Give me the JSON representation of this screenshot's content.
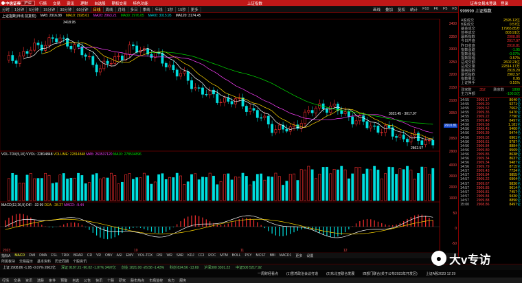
{
  "app": {
    "brand": "中信证券",
    "market_select": "沪深",
    "center_title": "上证指数",
    "menu": [
      "行情",
      "交易",
      "资讯",
      "理财",
      "自选股",
      "期权交易",
      "特色功能"
    ],
    "right_menu": [
      "证券交易未登录",
      "登录"
    ]
  },
  "toolbar": {
    "periods": [
      "分时",
      "1分钟",
      "5分钟",
      "15分钟",
      "30分钟",
      "60分钟",
      "日线",
      "周线",
      "月线",
      "多日",
      "季线",
      "年线",
      "1秒",
      "15秒",
      "更多"
    ],
    "active_period": "日线",
    "tools": [
      "画线",
      "叠加",
      "复权",
      "统计",
      "F10",
      "F6",
      "F5",
      "F3"
    ],
    "code": "999999",
    "code_name": "上证指数"
  },
  "main_info": {
    "label": "上证指数(日线 前复权)",
    "ma_label": "MA5: 2916.88",
    "ma10": "MA10: 2928.61",
    "ma20": "MA20: 2963.21",
    "ma30": "MA30: 2976.05",
    "ma60": "MA60: 3015.95",
    "ma120": "MA120: 3174.45"
  },
  "price_axis": [
    "3400",
    "3350",
    "3300",
    "3250",
    "3200",
    "3150",
    "3100",
    "3050",
    "3000",
    "2950",
    "2900"
  ],
  "annotations": {
    "high": "3418.95",
    "low": "2862.57",
    "mid": "3023.45 - 3017.97"
  },
  "current_tag": "2910.81",
  "volume_info": {
    "label": "VOL-TDX(5,10)",
    "vvol": "VVOL: 22814848",
    "volume": "VOLUME: 22814848",
    "ma5": "MA5: 263537120",
    "ma10": "MA10: 278534896"
  },
  "volume_axis": [
    "4000",
    "3000",
    "2000",
    "1000"
  ],
  "macd_info": {
    "label": "MACD(12,26,9)",
    "dif": "DIF: -32.99",
    "dea": "DEA: -28.27",
    "macd": "MACD: -9.44"
  },
  "macd_axis": [
    "50",
    "0",
    "-50"
  ],
  "months": [
    "2023",
    "10",
    "11",
    "12"
  ],
  "indicator_tabs": [
    "指标A",
    "MACD",
    "DMI",
    "DMA",
    "FSL",
    "TRIX",
    "BRAR",
    "CR",
    "VR",
    "OBV",
    "ASI",
    "EMV",
    "VOL-TDX",
    "RSI",
    "WR",
    "SAR",
    "KDJ",
    "CCI",
    "ROC",
    "MTM",
    "BOLL",
    "PSY",
    "MCST",
    "BBI",
    "MACD1",
    "更多",
    "设置"
  ],
  "sub_tabs": [
    "所属板块",
    "交易提示",
    "基本资料",
    "历史同期",
    "个股资讯"
  ],
  "quote_panel": {
    "rows": [
      {
        "l": "A股成交",
        "v": "2595.12亿"
      },
      {
        "l": "B股成交",
        "v": "0.57亿"
      },
      {
        "l": "基金成交",
        "v": "17965.85万"
      },
      {
        "l": "债券成交",
        "v": "803.91亿"
      },
      {
        "l": "最新指数",
        "v": "2908.86"
      },
      {
        "l": "今日开盘",
        "v": "2917.97"
      },
      {
        "l": "昨日收盘",
        "v": "2910.81"
      },
      {
        "l": "指数涨跌",
        "v": "-1.95"
      },
      {
        "l": "指数涨幅",
        "v": "-0.07%"
      },
      {
        "l": "指数振幅",
        "v": "0.57%"
      },
      {
        "l": "总成交额",
        "v": "2602.21亿"
      },
      {
        "l": "总成交量",
        "v": "22814.17万"
      },
      {
        "l": "最高指数",
        "v": "2919.20"
      },
      {
        "l": "最低指数",
        "v": "2902.57"
      },
      {
        "l": "指数量比",
        "v": "0.95"
      },
      {
        "l": "上证换手",
        "v": "0.51%"
      }
    ],
    "updown": {
      "l": "涨家数",
      "v": "352",
      "l2": "跌家数",
      "v2": "1898"
    },
    "main_force": {
      "l": "主力净额",
      "v": "-100.5亿"
    },
    "ticks": [
      [
        "14:55",
        "2909.17",
        "8646",
        "仑"
      ],
      [
        "14:55",
        "2909.20",
        "9271",
        "仑"
      ],
      [
        "14:55",
        "2909.52",
        "7662",
        "仑"
      ],
      [
        "14:55",
        "2909.35",
        "6470",
        "仑"
      ],
      [
        "14:55",
        "2909.22",
        "7790",
        "仑"
      ],
      [
        "14:55",
        "2909.40",
        "8497",
        "仑"
      ],
      [
        "14:56",
        "2909.58",
        "1,181",
        "仑"
      ],
      [
        "14:56",
        "2909.45",
        "9400",
        "仑"
      ],
      [
        "14:56",
        "2909.39",
        "9474",
        "仑"
      ],
      [
        "14:56",
        "2909.02",
        "6961",
        "仑"
      ],
      [
        "14:56",
        "2909.61",
        "9787",
        "仑"
      ],
      [
        "14:56",
        "2909.84",
        "8884",
        "仑"
      ],
      [
        "14:56",
        "2909.80",
        "9569",
        "仑"
      ],
      [
        "14:56",
        "2909.85",
        "8638",
        "仑"
      ],
      [
        "14:56",
        "2909.34",
        "8637",
        "仑"
      ],
      [
        "14:56",
        "2909.34",
        "9487",
        "仑"
      ],
      [
        "14:56",
        "2909.79",
        "8715",
        "仑"
      ],
      [
        "14:57",
        "2909.43",
        "7734",
        "仑"
      ],
      [
        "14:57",
        "2909.84",
        "9855",
        "仑"
      ],
      [
        "14:57",
        "2909.22",
        "6964",
        "仑"
      ],
      [
        "14:57",
        "2909.67",
        "9836",
        "仑"
      ],
      [
        "14:57",
        "2909.85",
        "9614",
        "仑"
      ],
      [
        "14:57",
        "2909.81",
        "7457",
        "仑"
      ],
      [
        "14:57",
        "2909.84",
        "9436",
        "仑"
      ],
      [
        "14:57",
        "2909.88",
        "8896",
        "仑"
      ],
      [
        "15:00",
        "2908.86",
        "8497",
        "仑"
      ]
    ]
  },
  "status1": [
    "上证 2908.86 -1.95 -0.07% 2602亿",
    "深证 9187.21 -90.02 -1.07% 3497亿",
    "创业 1821.00 -26.58 -1.43%",
    "科创 824.56 -13.69",
    "沪深300 3301.22",
    "中证500 5217.92"
  ],
  "news": [
    "一周财经看点",
    "(1)雪湾政治会议打造",
    "(2)东北亚联合发展",
    "四部门联合(关于公布2023年开发区)",
    "上证A股2023 12 29"
  ],
  "status2": [
    "行情",
    "交易",
    "资讯",
    "选股",
    "条件",
    "预警",
    "自选",
    "公告",
    "快讯",
    "个股",
    "研究",
    "股市热点",
    "市场监控",
    "东方",
    "服务"
  ],
  "watermark": "大v专访",
  "colors": {
    "up": "#ff3030",
    "down": "#00dede",
    "ma5": "#ffffff",
    "ma10": "#ffd700",
    "ma20": "#ff40ff",
    "ma60": "#00e000"
  }
}
